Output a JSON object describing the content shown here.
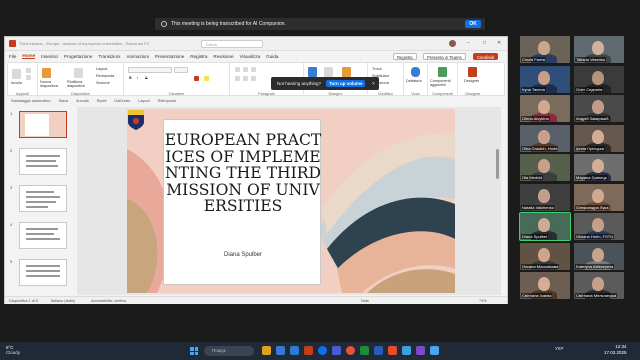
{
  "zoom_banner": {
    "text": "This meeting is being transcribed for AI Companion.",
    "ok_label": "OK"
  },
  "ppt": {
    "document_title": "Third mission - Europe...ractices of eupropean universities - Salvat sul PC",
    "search_placeholder": "Cerca",
    "toast": {
      "text": "Not hearing anything?",
      "button": "Turn up volume"
    },
    "menu_tabs": [
      "File",
      "Home",
      "Inserisci",
      "Progettazione",
      "Transizioni",
      "Animazioni",
      "Presentazione",
      "Registra",
      "Revisione",
      "Visualizza",
      "Guida"
    ],
    "active_tab": "Home",
    "menu_buttons": {
      "record": "Registra",
      "present": "Presenta in Teams",
      "share": "Condividi"
    },
    "ribbon_groups": [
      {
        "label": "Appunti",
        "items": [
          "Incolla"
        ]
      },
      {
        "label": "Diapositive",
        "items": [
          "Nuova diapositiva",
          "Riutilizza diapositive",
          "Layout",
          "Reimposta",
          "Sezione"
        ]
      },
      {
        "label": "Carattere",
        "items": [
          "B",
          "I",
          "S"
        ]
      },
      {
        "label": "Paragrafo",
        "items": []
      },
      {
        "label": "Disegno",
        "items": [
          "Forme",
          "Disponi",
          "Stili rapidi"
        ]
      },
      {
        "label": "Modifica",
        "items": [
          "Trova",
          "Sostituisci",
          "Seleziona"
        ]
      },
      {
        "label": "Voce",
        "items": [
          "Dettatura"
        ]
      },
      {
        "label": "Componenti",
        "items": [
          "Componenti aggiuntivi"
        ]
      },
      {
        "label": "Designer",
        "items": [
          "Designer"
        ]
      }
    ],
    "qat": [
      "Salvataggio automatico",
      "Salva",
      "Annulla",
      "Ripeti",
      "Dall'inizio",
      "Layout",
      "Reimposta"
    ],
    "slide_numbers": [
      "1",
      "2",
      "3",
      "4",
      "5"
    ],
    "slide": {
      "title": "EUROPEAN PRACTICES OF IMPLEMENTING THE THIRD MISSION OF UNIVERSITIES",
      "author": "Diana Spulber"
    },
    "status": {
      "slide_counter": "Diapositiva 1 di 5",
      "language": "Italiano (Italia)",
      "accessibility": "Accessibilità: verifica",
      "notes": "Note",
      "zoom": "73%"
    }
  },
  "participants": [
    {
      "name": "Cinzia Farrisi",
      "skin": "#c9a58d",
      "bg": "#6b6258",
      "shirt": "#2b3d5c"
    },
    {
      "name": "Tatiana Vasenko",
      "skin": "#d2b19a",
      "bg": "#5e6a70",
      "shirt": "#444"
    },
    {
      "name": "Iryna Taneva",
      "skin": "#c99d86",
      "bg": "#2f4f7a",
      "shirt": "#1f2f4a"
    },
    {
      "name": "Олег Седнягів",
      "skin": "#b6917c",
      "bg": "#3b3b3b",
      "shirt": "#222"
    },
    {
      "name": "Olena Aloykina",
      "skin": "#d1a78f",
      "bg": "#7a6c5c",
      "shirt": "#8a2c3a"
    },
    {
      "name": "Андрій Закирзкий",
      "skin": "#c39b86",
      "bg": "#4a4a4a",
      "shirt": "#333"
    },
    {
      "name": "Olha Gradich, Horbi",
      "skin": "#caa08b",
      "bg": "#59606a",
      "shirt": "#5a3c2c"
    },
    {
      "name": "Ірина Гірінцька",
      "skin": "#d4ac93",
      "bg": "#66584c",
      "shirt": "#2a2a2a"
    },
    {
      "name": "Ola Medvid",
      "skin": "#c7a089",
      "bg": "#555f4c",
      "shirt": "#3e3e3e"
    },
    {
      "name": "Марина Гринець",
      "skin": "#d3ae96",
      "bg": "#6d6d6d",
      "shirt": "#2d2d44"
    },
    {
      "name": "Natalia Valchenko",
      "skin": "#c49e89",
      "bg": "#3f3f3f",
      "shirt": "#444"
    },
    {
      "name": "Олександра Лука",
      "skin": "#d0a990",
      "bg": "#7d6a58",
      "shirt": "#6a4e3a"
    },
    {
      "name": "Diana Spulber",
      "skin": "#d2aa91",
      "bg": "#476b58",
      "shirt": "#2c2c2c"
    },
    {
      "name": "Oksana Horin, FSTU",
      "skin": "#c59f8a",
      "bg": "#5a5a5a",
      "shirt": "#2a3a5a"
    },
    {
      "name": "Оксана Мосьмікова",
      "skin": "#cda48e",
      "bg": "#615344",
      "shirt": "#3a3a3a"
    },
    {
      "name": "Kateryna Alekseyeva",
      "skin": "#c9a28c",
      "bg": "#4c5358",
      "shirt": "#7a7a7a"
    },
    {
      "name": "Світлана Ісаєва",
      "skin": "#d4ae95",
      "bg": "#6c5e52",
      "shirt": "#4a3a2a"
    },
    {
      "name": "Світлана Мельничука",
      "skin": "#c7a08b",
      "bg": "#5b5b5b",
      "shirt": "#2c2c2c"
    }
  ],
  "taskbar": {
    "weather_temp": "5°C",
    "weather_desc": "Cloudy",
    "search_placeholder": "Пошук",
    "language": "УКР",
    "time": "12:34",
    "date": "17.03.2025"
  }
}
